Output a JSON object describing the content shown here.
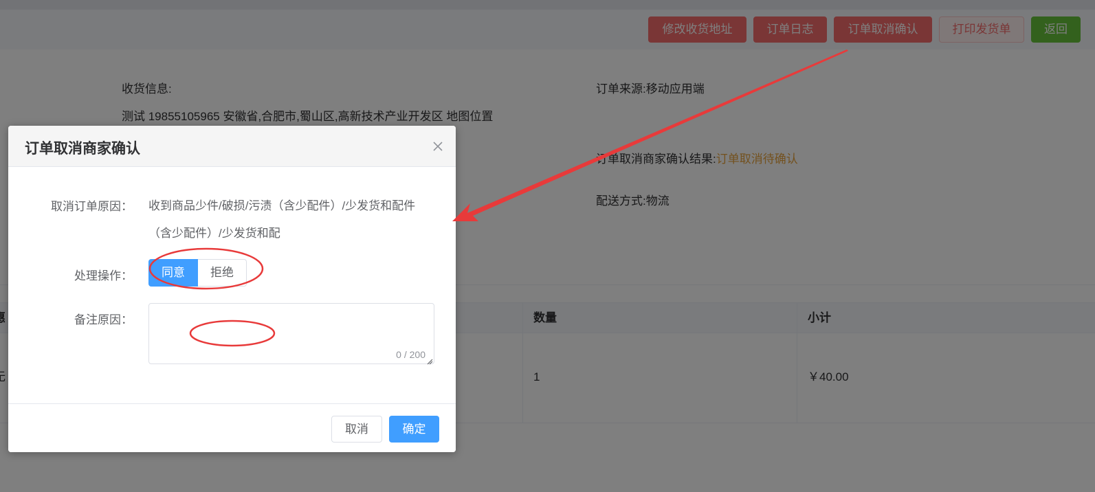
{
  "toolbar": {
    "buttons": [
      {
        "label": "修改收货地址"
      },
      {
        "label": "订单日志"
      },
      {
        "label": "订单取消确认"
      },
      {
        "label": "打印发货单"
      },
      {
        "label": "返回"
      }
    ]
  },
  "order_info": {
    "shipping_label": "收货信息:",
    "shipping_value": "测试 19855105965 安徽省,合肥市,蜀山区,高新技术产业开发区 地图位置",
    "source_label": "订单来源:",
    "source_value": "移动应用端",
    "cancel_result_label": "订单取消商家确认结果:",
    "cancel_result_value": "订单取消待确认",
    "delivery_label": "配送方式:",
    "delivery_value": "物流"
  },
  "table": {
    "headers": [
      "惠",
      "数量",
      "小计"
    ],
    "row": {
      "col1": "无",
      "quantity": "1",
      "subtotal": "￥40.00"
    }
  },
  "dialog": {
    "title": "订单取消商家确认",
    "close_icon": "close-icon",
    "reason_label": "取消订单原因：",
    "reason_value": "收到商品少件/破损/污渍（含少配件）/少发货和配件（含少配件）/少发货和配",
    "action_label": "处理操作：",
    "action_options": [
      "同意",
      "拒绝"
    ],
    "action_selected": "同意",
    "remark_label": "备注原因：",
    "remark_value": "",
    "remark_counter": "0 / 200",
    "cancel_label": "取消",
    "confirm_label": "确定"
  },
  "colors": {
    "danger": "#f56c6c",
    "success": "#67c23a",
    "primary": "#409eff",
    "warning": "#e6a23c",
    "annotation": "#e83a3a"
  }
}
